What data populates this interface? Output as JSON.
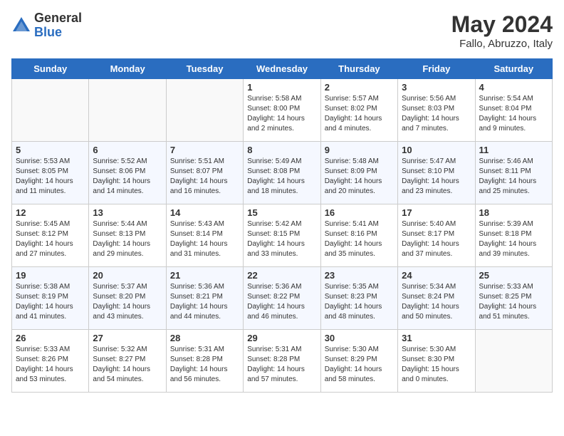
{
  "header": {
    "logo_general": "General",
    "logo_blue": "Blue",
    "month_year": "May 2024",
    "location": "Fallo, Abruzzo, Italy"
  },
  "days_of_week": [
    "Sunday",
    "Monday",
    "Tuesday",
    "Wednesday",
    "Thursday",
    "Friday",
    "Saturday"
  ],
  "weeks": [
    [
      {
        "num": "",
        "sunrise": "",
        "sunset": "",
        "daylight": ""
      },
      {
        "num": "",
        "sunrise": "",
        "sunset": "",
        "daylight": ""
      },
      {
        "num": "",
        "sunrise": "",
        "sunset": "",
        "daylight": ""
      },
      {
        "num": "1",
        "sunrise": "Sunrise: 5:58 AM",
        "sunset": "Sunset: 8:00 PM",
        "daylight": "Daylight: 14 hours and 2 minutes."
      },
      {
        "num": "2",
        "sunrise": "Sunrise: 5:57 AM",
        "sunset": "Sunset: 8:02 PM",
        "daylight": "Daylight: 14 hours and 4 minutes."
      },
      {
        "num": "3",
        "sunrise": "Sunrise: 5:56 AM",
        "sunset": "Sunset: 8:03 PM",
        "daylight": "Daylight: 14 hours and 7 minutes."
      },
      {
        "num": "4",
        "sunrise": "Sunrise: 5:54 AM",
        "sunset": "Sunset: 8:04 PM",
        "daylight": "Daylight: 14 hours and 9 minutes."
      }
    ],
    [
      {
        "num": "5",
        "sunrise": "Sunrise: 5:53 AM",
        "sunset": "Sunset: 8:05 PM",
        "daylight": "Daylight: 14 hours and 11 minutes."
      },
      {
        "num": "6",
        "sunrise": "Sunrise: 5:52 AM",
        "sunset": "Sunset: 8:06 PM",
        "daylight": "Daylight: 14 hours and 14 minutes."
      },
      {
        "num": "7",
        "sunrise": "Sunrise: 5:51 AM",
        "sunset": "Sunset: 8:07 PM",
        "daylight": "Daylight: 14 hours and 16 minutes."
      },
      {
        "num": "8",
        "sunrise": "Sunrise: 5:49 AM",
        "sunset": "Sunset: 8:08 PM",
        "daylight": "Daylight: 14 hours and 18 minutes."
      },
      {
        "num": "9",
        "sunrise": "Sunrise: 5:48 AM",
        "sunset": "Sunset: 8:09 PM",
        "daylight": "Daylight: 14 hours and 20 minutes."
      },
      {
        "num": "10",
        "sunrise": "Sunrise: 5:47 AM",
        "sunset": "Sunset: 8:10 PM",
        "daylight": "Daylight: 14 hours and 23 minutes."
      },
      {
        "num": "11",
        "sunrise": "Sunrise: 5:46 AM",
        "sunset": "Sunset: 8:11 PM",
        "daylight": "Daylight: 14 hours and 25 minutes."
      }
    ],
    [
      {
        "num": "12",
        "sunrise": "Sunrise: 5:45 AM",
        "sunset": "Sunset: 8:12 PM",
        "daylight": "Daylight: 14 hours and 27 minutes."
      },
      {
        "num": "13",
        "sunrise": "Sunrise: 5:44 AM",
        "sunset": "Sunset: 8:13 PM",
        "daylight": "Daylight: 14 hours and 29 minutes."
      },
      {
        "num": "14",
        "sunrise": "Sunrise: 5:43 AM",
        "sunset": "Sunset: 8:14 PM",
        "daylight": "Daylight: 14 hours and 31 minutes."
      },
      {
        "num": "15",
        "sunrise": "Sunrise: 5:42 AM",
        "sunset": "Sunset: 8:15 PM",
        "daylight": "Daylight: 14 hours and 33 minutes."
      },
      {
        "num": "16",
        "sunrise": "Sunrise: 5:41 AM",
        "sunset": "Sunset: 8:16 PM",
        "daylight": "Daylight: 14 hours and 35 minutes."
      },
      {
        "num": "17",
        "sunrise": "Sunrise: 5:40 AM",
        "sunset": "Sunset: 8:17 PM",
        "daylight": "Daylight: 14 hours and 37 minutes."
      },
      {
        "num": "18",
        "sunrise": "Sunrise: 5:39 AM",
        "sunset": "Sunset: 8:18 PM",
        "daylight": "Daylight: 14 hours and 39 minutes."
      }
    ],
    [
      {
        "num": "19",
        "sunrise": "Sunrise: 5:38 AM",
        "sunset": "Sunset: 8:19 PM",
        "daylight": "Daylight: 14 hours and 41 minutes."
      },
      {
        "num": "20",
        "sunrise": "Sunrise: 5:37 AM",
        "sunset": "Sunset: 8:20 PM",
        "daylight": "Daylight: 14 hours and 43 minutes."
      },
      {
        "num": "21",
        "sunrise": "Sunrise: 5:36 AM",
        "sunset": "Sunset: 8:21 PM",
        "daylight": "Daylight: 14 hours and 44 minutes."
      },
      {
        "num": "22",
        "sunrise": "Sunrise: 5:36 AM",
        "sunset": "Sunset: 8:22 PM",
        "daylight": "Daylight: 14 hours and 46 minutes."
      },
      {
        "num": "23",
        "sunrise": "Sunrise: 5:35 AM",
        "sunset": "Sunset: 8:23 PM",
        "daylight": "Daylight: 14 hours and 48 minutes."
      },
      {
        "num": "24",
        "sunrise": "Sunrise: 5:34 AM",
        "sunset": "Sunset: 8:24 PM",
        "daylight": "Daylight: 14 hours and 50 minutes."
      },
      {
        "num": "25",
        "sunrise": "Sunrise: 5:33 AM",
        "sunset": "Sunset: 8:25 PM",
        "daylight": "Daylight: 14 hours and 51 minutes."
      }
    ],
    [
      {
        "num": "26",
        "sunrise": "Sunrise: 5:33 AM",
        "sunset": "Sunset: 8:26 PM",
        "daylight": "Daylight: 14 hours and 53 minutes."
      },
      {
        "num": "27",
        "sunrise": "Sunrise: 5:32 AM",
        "sunset": "Sunset: 8:27 PM",
        "daylight": "Daylight: 14 hours and 54 minutes."
      },
      {
        "num": "28",
        "sunrise": "Sunrise: 5:31 AM",
        "sunset": "Sunset: 8:28 PM",
        "daylight": "Daylight: 14 hours and 56 minutes."
      },
      {
        "num": "29",
        "sunrise": "Sunrise: 5:31 AM",
        "sunset": "Sunset: 8:28 PM",
        "daylight": "Daylight: 14 hours and 57 minutes."
      },
      {
        "num": "30",
        "sunrise": "Sunrise: 5:30 AM",
        "sunset": "Sunset: 8:29 PM",
        "daylight": "Daylight: 14 hours and 58 minutes."
      },
      {
        "num": "31",
        "sunrise": "Sunrise: 5:30 AM",
        "sunset": "Sunset: 8:30 PM",
        "daylight": "Daylight: 15 hours and 0 minutes."
      },
      {
        "num": "",
        "sunrise": "",
        "sunset": "",
        "daylight": ""
      }
    ]
  ]
}
